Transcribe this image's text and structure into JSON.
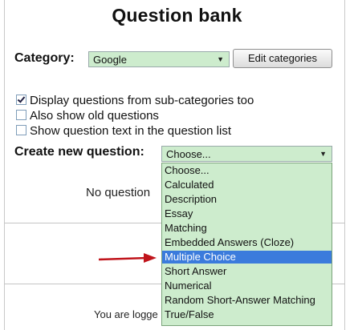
{
  "page": {
    "title": "Question bank"
  },
  "category": {
    "label": "Category:",
    "selected": "Google",
    "edit_button": "Edit categories"
  },
  "options": [
    {
      "label": "Display questions from sub-categories too",
      "checked": true
    },
    {
      "label": "Also show old questions",
      "checked": false
    },
    {
      "label": "Show question text in the question list",
      "checked": false
    }
  ],
  "create": {
    "label": "Create new question:",
    "selected": "Choose..."
  },
  "partial_text": {
    "no_questions": "No question",
    "logged_in": "You are logge"
  },
  "dropdown": {
    "items": [
      "Choose...",
      "Calculated",
      "Description",
      "Essay",
      "Matching",
      "Embedded Answers (Cloze)",
      "Multiple Choice",
      "Short Answer",
      "Numerical",
      "Random Short-Answer Matching",
      "True/False"
    ],
    "highlighted": "Multiple Choice"
  },
  "colors": {
    "select_bg": "#cdeccd",
    "highlight": "#3b7bdc",
    "arrow": "#c0141b"
  },
  "icons": {
    "dropdown_arrow": "chevron-down-icon",
    "pointer_arrow": "red-arrow-icon"
  }
}
